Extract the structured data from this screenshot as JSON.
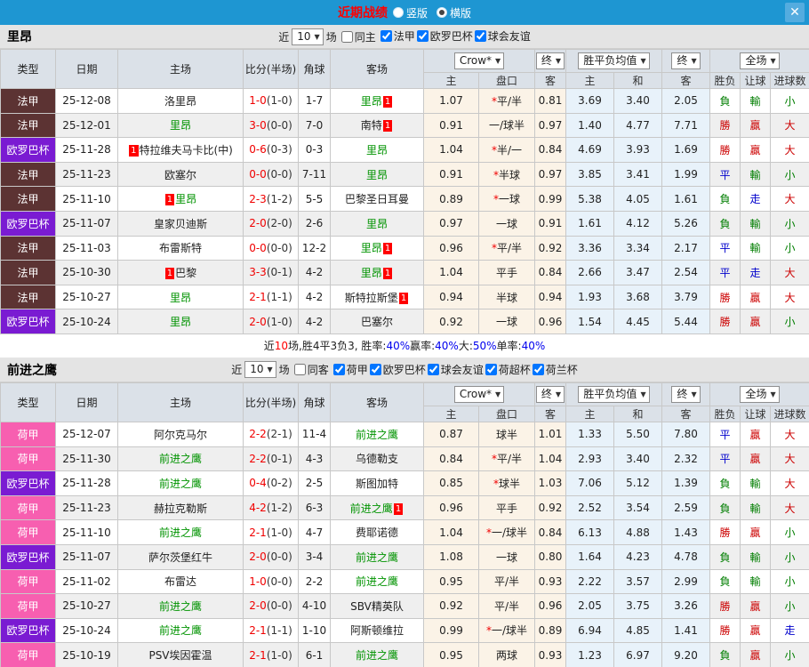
{
  "titlebar": {
    "title": "近期战绩",
    "vertical_label": "竖版",
    "horizontal_label": "横版",
    "close_icon": "✕"
  },
  "table_header": {
    "type": "类型",
    "date": "日期",
    "home": "主场",
    "score": "比分(半场)",
    "corner": "角球",
    "away": "客场",
    "odds_select": "Crow*",
    "final_select1": "终",
    "avg_select": "胜平负均值",
    "final_select2": "终",
    "full_select": "全场",
    "sub_home": "主",
    "sub_handicap": "盘口",
    "sub_away": "客",
    "sub_avg_home": "主",
    "sub_avg_draw": "和",
    "sub_avg_away": "客",
    "sub_wdl": "胜负",
    "sub_let": "让球",
    "sub_goals": "进球数"
  },
  "colors": {
    "topbar": "#1E96D2",
    "ligue1": "#5C3333",
    "europa": "#7A1BD2",
    "eredivisie": "#F75FB0",
    "win_red": "#CC0000",
    "lose_green": "#007E00",
    "draw_blue": "#0000CC",
    "team_green": "#009300",
    "score_red": "#F00000"
  },
  "sections": [
    {
      "team": "里昂",
      "near_label": "近",
      "count": "10",
      "games_label": "场",
      "same_label": "同主",
      "same_checked": false,
      "leagues": [
        {
          "label": "法甲",
          "checked": true
        },
        {
          "label": "欧罗巴杯",
          "checked": true
        },
        {
          "label": "球会友谊",
          "checked": true
        }
      ],
      "rows": [
        {
          "type": "法甲",
          "type_cls": "bg-fr",
          "date": "25-12-08",
          "home": "洛里昂",
          "home_cls": "",
          "home_badge": "",
          "score": "1-0",
          "half": "(1-0)",
          "corner": "1-7",
          "away": "里昂",
          "away_cls": "tm-g",
          "away_badge": "1",
          "oh": "1.07",
          "star": "*",
          "hc": "平/半",
          "oa": "0.81",
          "ah": "3.69",
          "ad": "3.40",
          "aa": "2.05",
          "r1": "負",
          "r1c": "c-grn",
          "r2": "輸",
          "r2c": "c-grn",
          "r3": "小",
          "r3c": "c-grn"
        },
        {
          "type": "法甲",
          "type_cls": "bg-fr",
          "date": "25-12-01",
          "home": "里昂",
          "home_cls": "tm-g",
          "home_badge": "",
          "score": "3-0",
          "half": "(0-0)",
          "corner": "7-0",
          "away": "南特",
          "away_cls": "",
          "away_badge": "1",
          "oh": "0.91",
          "star": "",
          "hc": "一/球半",
          "oa": "0.97",
          "ah": "1.40",
          "ad": "4.77",
          "aa": "7.71",
          "r1": "勝",
          "r1c": "c-red",
          "r2": "贏",
          "r2c": "c-red",
          "r3": "大",
          "r3c": "c-red"
        },
        {
          "type": "欧罗巴杯",
          "type_cls": "bg-eu",
          "date": "25-11-28",
          "home": "特拉维夫马卡比(中)",
          "home_cls": "",
          "home_badge": "1",
          "score": "0-6",
          "half": "(0-3)",
          "corner": "0-3",
          "away": "里昂",
          "away_cls": "tm-g",
          "away_badge": "",
          "oh": "1.04",
          "star": "*",
          "hc": "半/一",
          "oa": "0.84",
          "ah": "4.69",
          "ad": "3.93",
          "aa": "1.69",
          "r1": "勝",
          "r1c": "c-red",
          "r2": "贏",
          "r2c": "c-red",
          "r3": "大",
          "r3c": "c-red"
        },
        {
          "type": "法甲",
          "type_cls": "bg-fr",
          "date": "25-11-23",
          "home": "欧塞尔",
          "home_cls": "",
          "home_badge": "",
          "score": "0-0",
          "half": "(0-0)",
          "corner": "7-11",
          "away": "里昂",
          "away_cls": "tm-g",
          "away_badge": "",
          "oh": "0.91",
          "star": "*",
          "hc": "半球",
          "oa": "0.97",
          "ah": "3.85",
          "ad": "3.41",
          "aa": "1.99",
          "r1": "平",
          "r1c": "c-blu",
          "r2": "輸",
          "r2c": "c-grn",
          "r3": "小",
          "r3c": "c-grn"
        },
        {
          "type": "法甲",
          "type_cls": "bg-fr",
          "date": "25-11-10",
          "home": "里昂",
          "home_cls": "tm-g",
          "home_badge": "1",
          "score": "2-3",
          "half": "(1-2)",
          "corner": "5-5",
          "away": "巴黎圣日耳曼",
          "away_cls": "",
          "away_badge": "",
          "oh": "0.89",
          "star": "*",
          "hc": "一球",
          "oa": "0.99",
          "ah": "5.38",
          "ad": "4.05",
          "aa": "1.61",
          "r1": "負",
          "r1c": "c-grn",
          "r2": "走",
          "r2c": "c-blu",
          "r3": "大",
          "r3c": "c-red"
        },
        {
          "type": "欧罗巴杯",
          "type_cls": "bg-eu",
          "date": "25-11-07",
          "home": "皇家贝迪斯",
          "home_cls": "",
          "home_badge": "",
          "score": "2-0",
          "half": "(2-0)",
          "corner": "2-6",
          "away": "里昂",
          "away_cls": "tm-g",
          "away_badge": "",
          "oh": "0.97",
          "star": "",
          "hc": "一球",
          "oa": "0.91",
          "ah": "1.61",
          "ad": "4.12",
          "aa": "5.26",
          "r1": "負",
          "r1c": "c-grn",
          "r2": "輸",
          "r2c": "c-grn",
          "r3": "小",
          "r3c": "c-grn"
        },
        {
          "type": "法甲",
          "type_cls": "bg-fr",
          "date": "25-11-03",
          "home": "布雷斯特",
          "home_cls": "",
          "home_badge": "",
          "score": "0-0",
          "half": "(0-0)",
          "corner": "12-2",
          "away": "里昂",
          "away_cls": "tm-g",
          "away_badge": "1",
          "oh": "0.96",
          "star": "*",
          "hc": "平/半",
          "oa": "0.92",
          "ah": "3.36",
          "ad": "3.34",
          "aa": "2.17",
          "r1": "平",
          "r1c": "c-blu",
          "r2": "輸",
          "r2c": "c-grn",
          "r3": "小",
          "r3c": "c-grn"
        },
        {
          "type": "法甲",
          "type_cls": "bg-fr",
          "date": "25-10-30",
          "home": "巴黎",
          "home_cls": "",
          "home_badge": "1",
          "score": "3-3",
          "half": "(0-1)",
          "corner": "4-2",
          "away": "里昂",
          "away_cls": "tm-g",
          "away_badge": "1",
          "oh": "1.04",
          "star": "",
          "hc": "平手",
          "oa": "0.84",
          "ah": "2.66",
          "ad": "3.47",
          "aa": "2.54",
          "r1": "平",
          "r1c": "c-blu",
          "r2": "走",
          "r2c": "c-blu",
          "r3": "大",
          "r3c": "c-red"
        },
        {
          "type": "法甲",
          "type_cls": "bg-fr",
          "date": "25-10-27",
          "home": "里昂",
          "home_cls": "tm-g",
          "home_badge": "",
          "score": "2-1",
          "half": "(1-1)",
          "corner": "4-2",
          "away": "斯特拉斯堡",
          "away_cls": "",
          "away_badge": "1",
          "oh": "0.94",
          "star": "",
          "hc": "半球",
          "oa": "0.94",
          "ah": "1.93",
          "ad": "3.68",
          "aa": "3.79",
          "r1": "勝",
          "r1c": "c-red",
          "r2": "贏",
          "r2c": "c-red",
          "r3": "大",
          "r3c": "c-red"
        },
        {
          "type": "欧罗巴杯",
          "type_cls": "bg-eu",
          "date": "25-10-24",
          "home": "里昂",
          "home_cls": "tm-g",
          "home_badge": "",
          "score": "2-0",
          "half": "(1-0)",
          "corner": "4-2",
          "away": "巴塞尔",
          "away_cls": "",
          "away_badge": "",
          "oh": "0.92",
          "star": "",
          "hc": "一球",
          "oa": "0.96",
          "ah": "1.54",
          "ad": "4.45",
          "aa": "5.44",
          "r1": "勝",
          "r1c": "c-red",
          "r2": "贏",
          "r2c": "c-red",
          "r3": "小",
          "r3c": "c-grn"
        }
      ],
      "stats": {
        "seg1": "近",
        "num": "10",
        "seg2": "场,胜4平3负3, 胜率:",
        "v1": "40%",
        "seg3": " 赢率:",
        "v2": "40%",
        "seg4": " 大:",
        "v3": "50%",
        "seg5": " 单率:",
        "v4": "40%"
      }
    },
    {
      "team": "前进之鹰",
      "near_label": "近",
      "count": "10",
      "games_label": "场",
      "same_label": "同客",
      "same_checked": false,
      "leagues": [
        {
          "label": "荷甲",
          "checked": true
        },
        {
          "label": "欧罗巴杯",
          "checked": true
        },
        {
          "label": "球会友谊",
          "checked": true
        },
        {
          "label": "荷超杯",
          "checked": true
        },
        {
          "label": "荷兰杯",
          "checked": true
        }
      ],
      "rows": [
        {
          "type": "荷甲",
          "type_cls": "bg-nl",
          "date": "25-12-07",
          "home": "阿尔克马尔",
          "home_cls": "",
          "home_badge": "",
          "score": "2-2",
          "half": "(2-1)",
          "corner": "11-4",
          "away": "前进之鹰",
          "away_cls": "tm-g",
          "away_badge": "",
          "oh": "0.87",
          "star": "",
          "hc": "球半",
          "oa": "1.01",
          "ah": "1.33",
          "ad": "5.50",
          "aa": "7.80",
          "r1": "平",
          "r1c": "c-blu",
          "r2": "贏",
          "r2c": "c-red",
          "r3": "大",
          "r3c": "c-red"
        },
        {
          "type": "荷甲",
          "type_cls": "bg-nl",
          "date": "25-11-30",
          "home": "前进之鹰",
          "home_cls": "tm-g",
          "home_badge": "",
          "score": "2-2",
          "half": "(0-1)",
          "corner": "4-3",
          "away": "乌德勒支",
          "away_cls": "",
          "away_badge": "",
          "oh": "0.84",
          "star": "*",
          "hc": "平/半",
          "oa": "1.04",
          "ah": "2.93",
          "ad": "3.40",
          "aa": "2.32",
          "r1": "平",
          "r1c": "c-blu",
          "r2": "贏",
          "r2c": "c-red",
          "r3": "大",
          "r3c": "c-red"
        },
        {
          "type": "欧罗巴杯",
          "type_cls": "bg-eu",
          "date": "25-11-28",
          "home": "前进之鹰",
          "home_cls": "tm-g",
          "home_badge": "",
          "score": "0-4",
          "half": "(0-2)",
          "corner": "2-5",
          "away": "斯图加特",
          "away_cls": "",
          "away_badge": "",
          "oh": "0.85",
          "star": "*",
          "hc": "球半",
          "oa": "1.03",
          "ah": "7.06",
          "ad": "5.12",
          "aa": "1.39",
          "r1": "負",
          "r1c": "c-grn",
          "r2": "輸",
          "r2c": "c-grn",
          "r3": "大",
          "r3c": "c-red"
        },
        {
          "type": "荷甲",
          "type_cls": "bg-nl",
          "date": "25-11-23",
          "home": "赫拉克勒斯",
          "home_cls": "",
          "home_badge": "",
          "score": "4-2",
          "half": "(1-2)",
          "corner": "6-3",
          "away": "前进之鹰",
          "away_cls": "tm-g",
          "away_badge": "1",
          "oh": "0.96",
          "star": "",
          "hc": "平手",
          "oa": "0.92",
          "ah": "2.52",
          "ad": "3.54",
          "aa": "2.59",
          "r1": "負",
          "r1c": "c-grn",
          "r2": "輸",
          "r2c": "c-grn",
          "r3": "大",
          "r3c": "c-red"
        },
        {
          "type": "荷甲",
          "type_cls": "bg-nl",
          "date": "25-11-10",
          "home": "前进之鹰",
          "home_cls": "tm-g",
          "home_badge": "",
          "score": "2-1",
          "half": "(1-0)",
          "corner": "4-7",
          "away": "费耶诺德",
          "away_cls": "",
          "away_badge": "",
          "oh": "1.04",
          "star": "*",
          "hc": "一/球半",
          "oa": "0.84",
          "ah": "6.13",
          "ad": "4.88",
          "aa": "1.43",
          "r1": "勝",
          "r1c": "c-red",
          "r2": "贏",
          "r2c": "c-red",
          "r3": "小",
          "r3c": "c-grn"
        },
        {
          "type": "欧罗巴杯",
          "type_cls": "bg-eu",
          "date": "25-11-07",
          "home": "萨尔茨堡红牛",
          "home_cls": "",
          "home_badge": "",
          "score": "2-0",
          "half": "(0-0)",
          "corner": "3-4",
          "away": "前进之鹰",
          "away_cls": "tm-g",
          "away_badge": "",
          "oh": "1.08",
          "star": "",
          "hc": "一球",
          "oa": "0.80",
          "ah": "1.64",
          "ad": "4.23",
          "aa": "4.78",
          "r1": "負",
          "r1c": "c-grn",
          "r2": "輸",
          "r2c": "c-grn",
          "r3": "小",
          "r3c": "c-grn"
        },
        {
          "type": "荷甲",
          "type_cls": "bg-nl",
          "date": "25-11-02",
          "home": "布雷达",
          "home_cls": "",
          "home_badge": "",
          "score": "1-0",
          "half": "(0-0)",
          "corner": "2-2",
          "away": "前进之鹰",
          "away_cls": "tm-g",
          "away_badge": "",
          "oh": "0.95",
          "star": "",
          "hc": "平/半",
          "oa": "0.93",
          "ah": "2.22",
          "ad": "3.57",
          "aa": "2.99",
          "r1": "負",
          "r1c": "c-grn",
          "r2": "輸",
          "r2c": "c-grn",
          "r3": "小",
          "r3c": "c-grn"
        },
        {
          "type": "荷甲",
          "type_cls": "bg-nl",
          "date": "25-10-27",
          "home": "前进之鹰",
          "home_cls": "tm-g",
          "home_badge": "",
          "score": "2-0",
          "half": "(0-0)",
          "corner": "4-10",
          "away": "SBV精英队",
          "away_cls": "",
          "away_badge": "",
          "oh": "0.92",
          "star": "",
          "hc": "平/半",
          "oa": "0.96",
          "ah": "2.05",
          "ad": "3.75",
          "aa": "3.26",
          "r1": "勝",
          "r1c": "c-red",
          "r2": "贏",
          "r2c": "c-red",
          "r3": "小",
          "r3c": "c-grn"
        },
        {
          "type": "欧罗巴杯",
          "type_cls": "bg-eu",
          "date": "25-10-24",
          "home": "前进之鹰",
          "home_cls": "tm-g",
          "home_badge": "",
          "score": "2-1",
          "half": "(1-1)",
          "corner": "1-10",
          "away": "阿斯顿维拉",
          "away_cls": "",
          "away_badge": "",
          "oh": "0.99",
          "star": "*",
          "hc": "一/球半",
          "oa": "0.89",
          "ah": "6.94",
          "ad": "4.85",
          "aa": "1.41",
          "r1": "勝",
          "r1c": "c-red",
          "r2": "贏",
          "r2c": "c-red",
          "r3": "走",
          "r3c": "c-blu"
        },
        {
          "type": "荷甲",
          "type_cls": "bg-nl",
          "date": "25-10-19",
          "home": "PSV埃因霍温",
          "home_cls": "",
          "home_badge": "",
          "score": "2-1",
          "half": "(1-0)",
          "corner": "6-1",
          "away": "前进之鹰",
          "away_cls": "tm-g",
          "away_badge": "",
          "oh": "0.95",
          "star": "",
          "hc": "两球",
          "oa": "0.93",
          "ah": "1.23",
          "ad": "6.97",
          "aa": "9.20",
          "r1": "負",
          "r1c": "c-grn",
          "r2": "贏",
          "r2c": "c-red",
          "r3": "小",
          "r3c": "c-grn"
        }
      ]
    }
  ]
}
